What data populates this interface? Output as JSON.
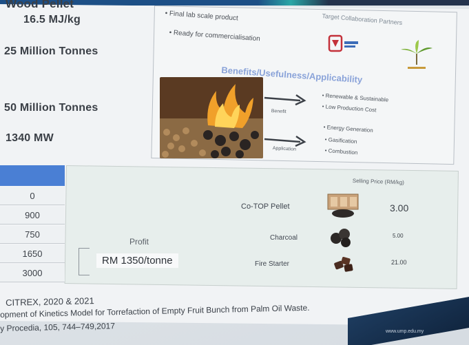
{
  "stats": [
    "16.5 MJ/kg",
    "25 Million Tonnes",
    "50 Million Tonnes",
    "1340 MW"
  ],
  "stats_partial_top": "Wood Pellet",
  "innovation": {
    "bullets": [
      "Final lab scale product",
      "Ready for commercialisation"
    ],
    "target_collaboration_title": "Target Collaboration Partners",
    "benefits_title": "Benefits/Usefulness/Applicability",
    "benefit_label": "Benefit",
    "application_label": "Application",
    "benefits": [
      "Renewable & Sustainable",
      "Low Production Cost"
    ],
    "applications": [
      "Energy Generation",
      "Gasification",
      "Combustion"
    ]
  },
  "values_table": [
    "0",
    "900",
    "750",
    "1650",
    "3000"
  ],
  "profit": {
    "label": "Profit",
    "value": "RM 1350/tonne"
  },
  "pricing": {
    "header": "Selling Price (RM/kg)",
    "products": [
      {
        "name": "Co-TOP Pellet",
        "price": "3.00"
      },
      {
        "name": "Charcoal",
        "price": "5.00"
      },
      {
        "name": "Fire Starter",
        "price": "21.00"
      }
    ]
  },
  "references": [
    "CITREX, 2020 & 2021",
    "opment of Kinetics Model for Torrefaction of Empty Fruit Bunch from Palm Oil Waste.",
    "y Procedia, 105, 744–749,2017"
  ],
  "footer_url": "www.ump.edu.my",
  "colors": {
    "header_blue": "#4a7fd4",
    "benefits_title": "#8aa3d9",
    "footer_navy": "#1d3b5e"
  }
}
